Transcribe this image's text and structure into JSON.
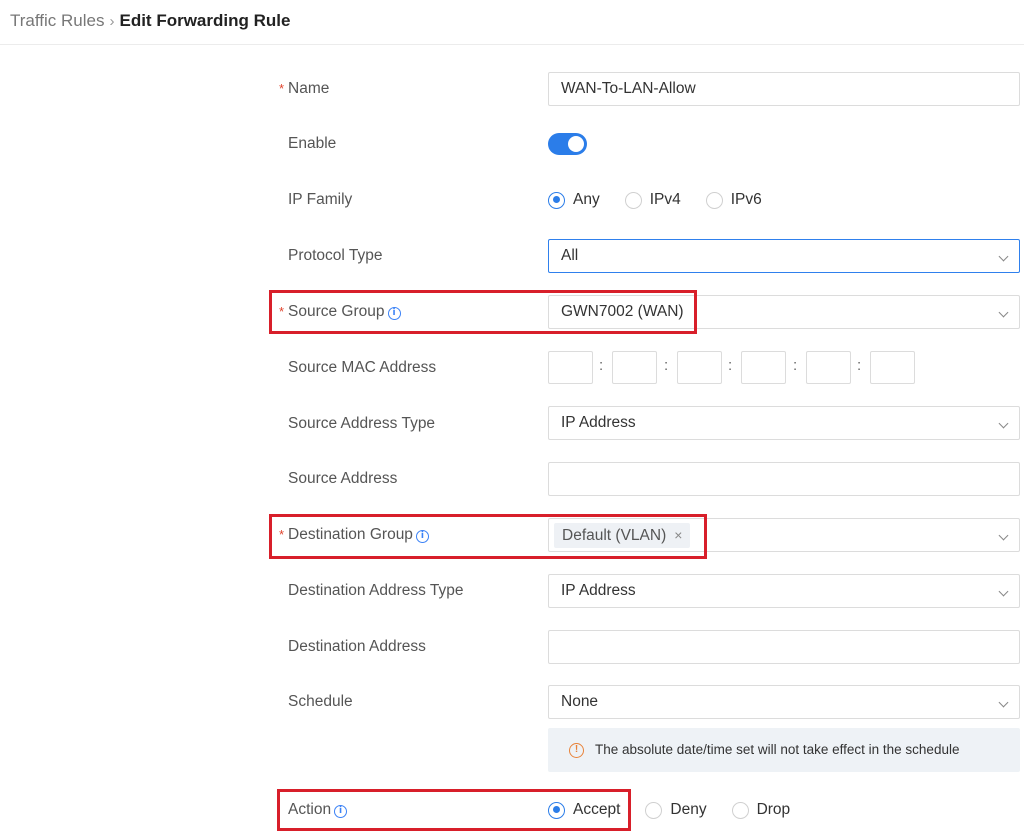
{
  "breadcrumb": {
    "parent": "Traffic Rules",
    "separator": "›",
    "current": "Edit Forwarding Rule"
  },
  "required_mark": "*",
  "form": {
    "name": {
      "label": "Name",
      "value": "WAN-To-LAN-Allow"
    },
    "enable": {
      "label": "Enable",
      "on": true
    },
    "ip_family": {
      "label": "IP Family",
      "options": [
        "Any",
        "IPv4",
        "IPv6"
      ],
      "selected": "Any"
    },
    "protocol_type": {
      "label": "Protocol Type",
      "value": "All"
    },
    "source_group": {
      "label": "Source Group",
      "value": "GWN7002 (WAN)"
    },
    "source_mac": {
      "label": "Source MAC Address",
      "separator": ":"
    },
    "source_address_type": {
      "label": "Source Address Type",
      "value": "IP Address"
    },
    "source_address": {
      "label": "Source Address",
      "value": ""
    },
    "destination_group": {
      "label": "Destination Group",
      "tag": "Default (VLAN)",
      "remove": "×"
    },
    "destination_address_type": {
      "label": "Destination Address Type",
      "value": "IP Address"
    },
    "destination_address": {
      "label": "Destination Address",
      "value": ""
    },
    "schedule": {
      "label": "Schedule",
      "value": "None",
      "notice": "The absolute date/time set will not take effect in the schedule"
    },
    "action": {
      "label": "Action",
      "options": [
        "Accept",
        "Deny",
        "Drop"
      ],
      "selected": "Accept"
    }
  },
  "icons": {
    "info": "info-icon",
    "warning": "warning-icon",
    "dropdown": "chevron-down-icon"
  },
  "colors": {
    "accent": "#2b7de9",
    "required": "#e0442d",
    "highlight": "#d81f2a",
    "warning": "#e8833a"
  }
}
